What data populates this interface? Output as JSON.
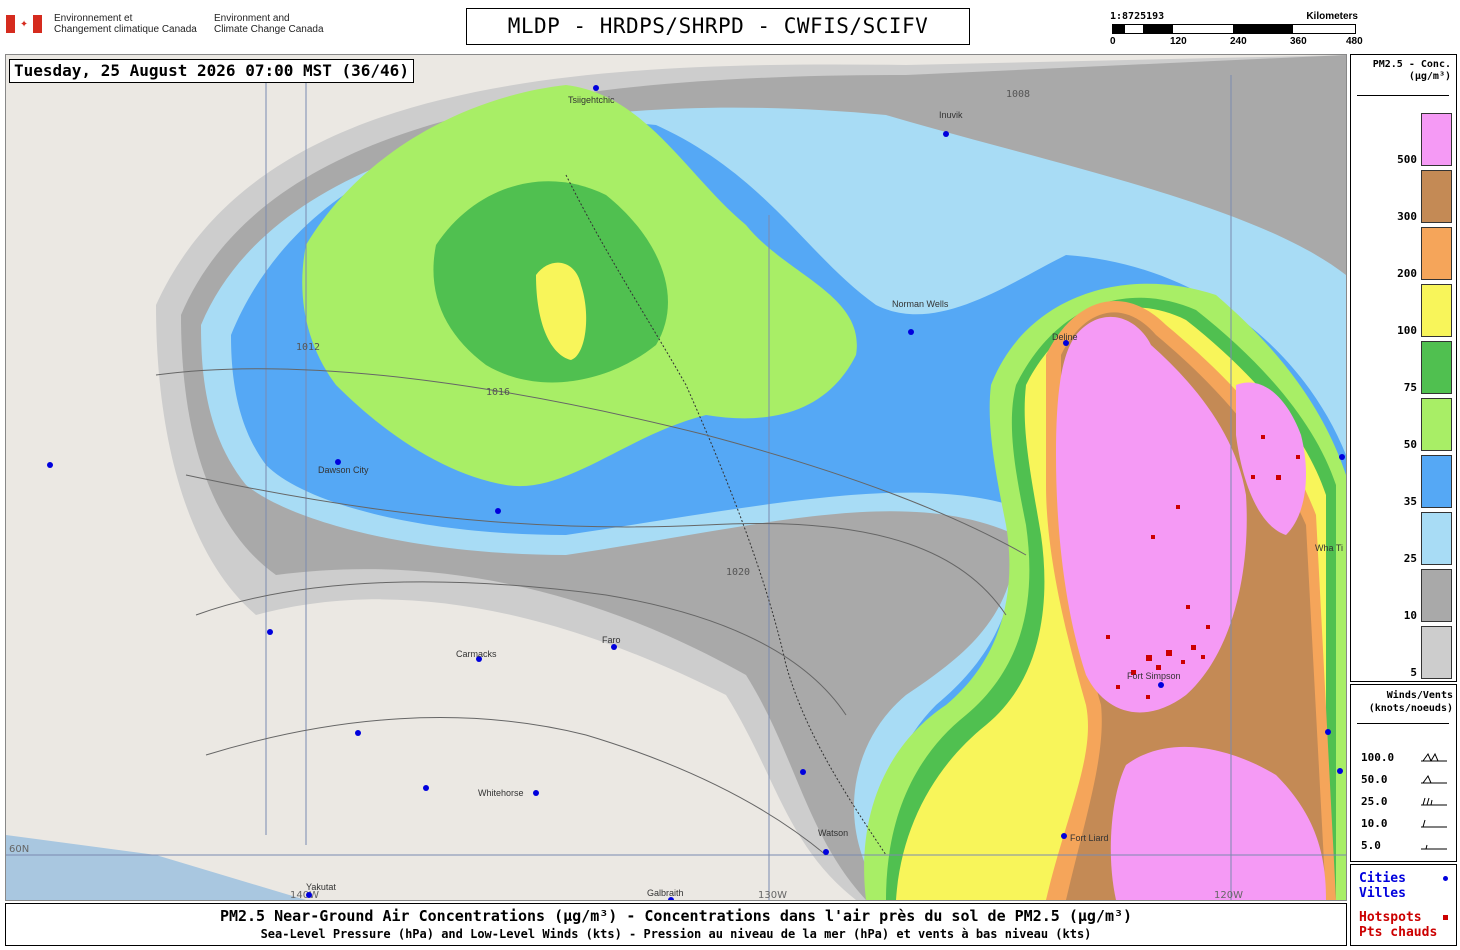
{
  "header": {
    "agency_fr": "Environnement et\nChangement climatique Canada",
    "agency_en": "Environment and\nClimate Change Canada",
    "title": "MLDP - HRDPS/SHRPD - CWFIS/SCIFV"
  },
  "scale": {
    "ratio": "1:8725193",
    "unit": "Kilometers",
    "ticks": [
      "0",
      "120",
      "240",
      "360",
      "480"
    ]
  },
  "timestamp": "Tuesday, 25 August 2026 07:00 MST (36/46)",
  "legend": {
    "title_line1": "PM2.5 - Conc.",
    "title_line2": "(µg/m³)",
    "bins": [
      {
        "label": "500",
        "color": "#f59af5"
      },
      {
        "label": "300",
        "color": "#c48a55"
      },
      {
        "label": "200",
        "color": "#f5a55a"
      },
      {
        "label": "100",
        "color": "#f8f55a"
      },
      {
        "label": "75",
        "color": "#50c050"
      },
      {
        "label": "50",
        "color": "#a8ee66"
      },
      {
        "label": "35",
        "color": "#55a8f5"
      },
      {
        "label": "25",
        "color": "#a8dcf5"
      },
      {
        "label": "10",
        "color": "#a9a9a9"
      },
      {
        "label": "5",
        "color": "#cdcdcd"
      }
    ]
  },
  "winds_legend": {
    "title_line1": "Winds/Vents",
    "title_line2": "(knots/noeuds)",
    "values": [
      "100.0",
      "50.0",
      "25.0",
      "10.0",
      "5.0"
    ]
  },
  "symbols": {
    "cities_en": "Cities",
    "cities_fr": "Villes",
    "cities_color": "#0000dd",
    "hotspots_en": "Hotspots",
    "hotspots_fr": "Pts chauds",
    "hotspots_color": "#cc0000"
  },
  "caption": {
    "line1": "PM2.5 Near-Ground Air Concentrations (µg/m³) - Concentrations dans l'air près du sol de PM2.5 (µg/m³)",
    "line2": "Sea-Level Pressure (hPa) and Low-Level Winds (kts) - Pression au niveau de la mer (hPa) et vents à bas niveau (kts)"
  },
  "map": {
    "cities": [
      "Dawson City",
      "Carmacks",
      "Faro",
      "Whitehorse",
      "Watson",
      "Fort Liard",
      "Fort Simpson",
      "Norman Wells",
      "Tsiigehtchic",
      "Yakutat",
      "Deline",
      "Inuvik",
      "Galbraith",
      "Wha Ti"
    ],
    "isobars": [
      "1008",
      "1012",
      "1016",
      "1020"
    ],
    "graticule": [
      "60N",
      "130W",
      "140W",
      "120W"
    ]
  }
}
